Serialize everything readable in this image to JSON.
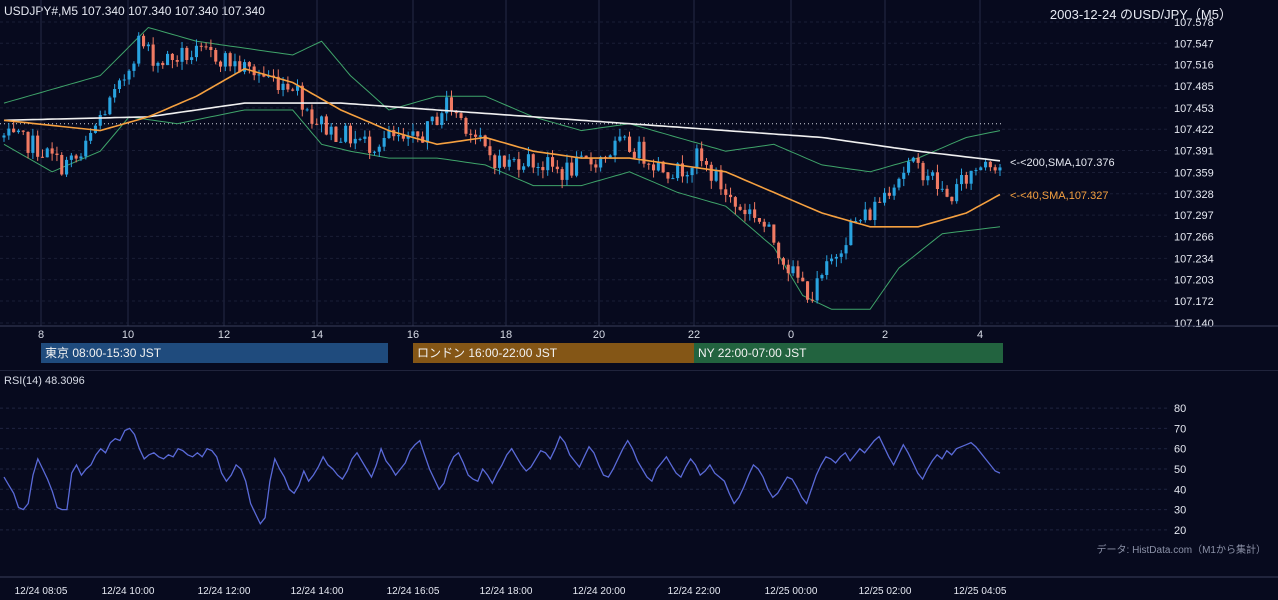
{
  "header": {
    "symbol_info": "USDJPY#,M5 107.340 107.340 107.340 107.340",
    "chart_title": "2003-12-24 のUSD/JPY（M5）"
  },
  "sessions": [
    {
      "label": "東京 08:00-15:30 JST",
      "color": "#1f4b7d"
    },
    {
      "label": "ロンドン 16:00-22:00 JST",
      "color": "#845616"
    },
    {
      "label": "NY 22:00-07:00 JST",
      "color": "#22633f"
    }
  ],
  "indicator_labels": {
    "sma200": "<-<200,SMA,107.376",
    "sma40": "<-<40,SMA,107.327"
  },
  "rsi_label": "RSI(14) 48.3096",
  "source_note": "データ: HistData.com（M1から集計）",
  "colors": {
    "background": "#070a1e",
    "bull": "#29a3e0",
    "bear": "#f07a63",
    "sma40": "#f5a040",
    "sma200": "#f0f0f0",
    "bollinger": "#3fa46a",
    "rsi": "#5a6ad8"
  },
  "chart_data": [
    {
      "type": "candlestick",
      "title": "USD/JPY M5",
      "x_tick_labels": [
        "8",
        "10",
        "12",
        "14",
        "16",
        "18",
        "20",
        "22",
        "0",
        "2",
        "4"
      ],
      "y_tick_labels": [
        "107.578",
        "107.547",
        "107.516",
        "107.485",
        "107.453",
        "107.422",
        "107.391",
        "107.359",
        "107.328",
        "107.297",
        "107.266",
        "107.234",
        "107.203",
        "107.172",
        "107.140"
      ],
      "ylim": [
        107.14,
        107.578
      ],
      "reference_line": 107.43,
      "grid": true,
      "close_path": [
        [
          0,
          107.41
        ],
        [
          6,
          107.4
        ],
        [
          12,
          107.37
        ],
        [
          16,
          107.38
        ],
        [
          20,
          107.44
        ],
        [
          24,
          107.48
        ],
        [
          28,
          107.55
        ],
        [
          32,
          107.52
        ],
        [
          38,
          107.53
        ],
        [
          44,
          107.53
        ],
        [
          50,
          107.51
        ],
        [
          54,
          107.5
        ],
        [
          58,
          107.49
        ],
        [
          60,
          107.49
        ],
        [
          64,
          107.44
        ],
        [
          68,
          107.42
        ],
        [
          72,
          107.41
        ],
        [
          76,
          107.4
        ],
        [
          80,
          107.41
        ],
        [
          84,
          107.4
        ],
        [
          88,
          107.42
        ],
        [
          92,
          107.46
        ],
        [
          96,
          107.43
        ],
        [
          100,
          107.39
        ],
        [
          104,
          107.37
        ],
        [
          108,
          107.38
        ],
        [
          112,
          107.37
        ],
        [
          116,
          107.36
        ],
        [
          120,
          107.37
        ],
        [
          124,
          107.38
        ],
        [
          128,
          107.4
        ],
        [
          132,
          107.39
        ],
        [
          136,
          107.37
        ],
        [
          140,
          107.36
        ],
        [
          144,
          107.38
        ],
        [
          148,
          107.35
        ],
        [
          152,
          107.31
        ],
        [
          156,
          107.3
        ],
        [
          160,
          107.26
        ],
        [
          164,
          107.21
        ],
        [
          168,
          107.18
        ],
        [
          172,
          107.23
        ],
        [
          176,
          107.28
        ],
        [
          180,
          107.3
        ],
        [
          184,
          107.34
        ],
        [
          188,
          107.37
        ],
        [
          192,
          107.36
        ],
        [
          196,
          107.32
        ],
        [
          200,
          107.35
        ],
        [
          204,
          107.38
        ],
        [
          207,
          107.37
        ]
      ],
      "sma40": [
        [
          0,
          107.435
        ],
        [
          20,
          107.42
        ],
        [
          30,
          107.44
        ],
        [
          40,
          107.47
        ],
        [
          50,
          107.51
        ],
        [
          60,
          107.49
        ],
        [
          70,
          107.45
        ],
        [
          80,
          107.42
        ],
        [
          90,
          107.4
        ],
        [
          100,
          107.41
        ],
        [
          110,
          107.39
        ],
        [
          120,
          107.38
        ],
        [
          130,
          107.38
        ],
        [
          140,
          107.37
        ],
        [
          150,
          107.36
        ],
        [
          160,
          107.33
        ],
        [
          170,
          107.3
        ],
        [
          180,
          107.28
        ],
        [
          190,
          107.28
        ],
        [
          200,
          107.3
        ],
        [
          207,
          107.327
        ]
      ],
      "sma200": [
        [
          0,
          107.435
        ],
        [
          30,
          107.44
        ],
        [
          50,
          107.46
        ],
        [
          70,
          107.46
        ],
        [
          90,
          107.45
        ],
        [
          110,
          107.44
        ],
        [
          130,
          107.43
        ],
        [
          150,
          107.42
        ],
        [
          170,
          107.41
        ],
        [
          190,
          107.39
        ],
        [
          207,
          107.376
        ]
      ],
      "bollinger_upper": [
        [
          0,
          107.46
        ],
        [
          20,
          107.5
        ],
        [
          30,
          107.57
        ],
        [
          40,
          107.55
        ],
        [
          50,
          107.54
        ],
        [
          60,
          107.53
        ],
        [
          66,
          107.55
        ],
        [
          72,
          107.5
        ],
        [
          80,
          107.45
        ],
        [
          90,
          107.47
        ],
        [
          100,
          107.47
        ],
        [
          110,
          107.44
        ],
        [
          120,
          107.42
        ],
        [
          130,
          107.43
        ],
        [
          140,
          107.41
        ],
        [
          150,
          107.39
        ],
        [
          160,
          107.4
        ],
        [
          170,
          107.37
        ],
        [
          180,
          107.36
        ],
        [
          190,
          107.38
        ],
        [
          200,
          107.41
        ],
        [
          207,
          107.42
        ]
      ],
      "bollinger_lower": [
        [
          0,
          107.4
        ],
        [
          10,
          107.36
        ],
        [
          20,
          107.39
        ],
        [
          26,
          107.44
        ],
        [
          36,
          107.43
        ],
        [
          50,
          107.45
        ],
        [
          60,
          107.45
        ],
        [
          66,
          107.4
        ],
        [
          72,
          107.39
        ],
        [
          80,
          107.38
        ],
        [
          90,
          107.38
        ],
        [
          100,
          107.37
        ],
        [
          110,
          107.34
        ],
        [
          120,
          107.34
        ],
        [
          130,
          107.36
        ],
        [
          140,
          107.33
        ],
        [
          150,
          107.31
        ],
        [
          160,
          107.25
        ],
        [
          166,
          107.18
        ],
        [
          172,
          107.16
        ],
        [
          180,
          107.16
        ],
        [
          186,
          107.22
        ],
        [
          195,
          107.27
        ],
        [
          207,
          107.28
        ]
      ]
    },
    {
      "type": "line",
      "title": "RSI(14)",
      "y_tick_labels": [
        "80",
        "70",
        "60",
        "50",
        "40",
        "30",
        "20"
      ],
      "ylim": [
        15,
        85
      ],
      "x_tick_labels": [
        "12/24 08:05",
        "12/24 10:00",
        "12/24 12:00",
        "12/24 14:00",
        "12/24 16:05",
        "12/24 18:00",
        "12/24 20:00",
        "12/24 22:00",
        "12/25 00:00",
        "12/25 02:00",
        "12/25 04:05"
      ],
      "values": [
        46,
        42,
        38,
        31,
        30,
        33,
        47,
        55,
        50,
        45,
        39,
        31,
        30,
        30,
        48,
        52,
        47,
        50,
        52,
        57,
        60,
        58,
        63,
        65,
        64,
        69,
        70,
        67,
        60,
        55,
        57,
        58,
        56,
        55,
        57,
        56,
        60,
        59,
        57,
        56,
        58,
        56,
        60,
        59,
        56,
        48,
        44,
        47,
        52,
        50,
        44,
        33,
        28,
        23,
        26,
        44,
        55,
        50,
        46,
        40,
        38,
        42,
        49,
        44,
        47,
        51,
        56,
        52,
        50,
        47,
        45,
        49,
        55,
        58,
        54,
        50,
        46,
        52,
        60,
        54,
        51,
        47,
        50,
        53,
        59,
        62,
        64,
        57,
        50,
        45,
        40,
        43,
        51,
        56,
        58,
        53,
        47,
        45,
        44,
        50,
        47,
        43,
        48,
        52,
        57,
        60,
        56,
        52,
        49,
        51,
        55,
        59,
        58,
        55,
        60,
        66,
        63,
        57,
        54,
        51,
        56,
        61,
        58,
        52,
        47,
        46,
        50,
        55,
        60,
        64,
        60,
        54,
        50,
        46,
        44,
        50,
        53,
        56,
        52,
        48,
        46,
        51,
        55,
        52,
        47,
        49,
        52,
        48,
        46,
        44,
        38,
        33,
        36,
        41,
        47,
        52,
        50,
        46,
        40,
        36,
        38,
        42,
        46,
        45,
        41,
        36,
        33,
        40,
        47,
        52,
        56,
        55,
        53,
        56,
        58,
        54,
        57,
        60,
        58,
        61,
        64,
        66,
        61,
        56,
        52,
        57,
        62,
        58,
        53,
        48,
        45,
        50,
        54,
        57,
        55,
        59,
        57,
        60,
        61,
        62,
        63,
        61,
        58,
        55,
        52,
        49,
        48
      ]
    }
  ]
}
